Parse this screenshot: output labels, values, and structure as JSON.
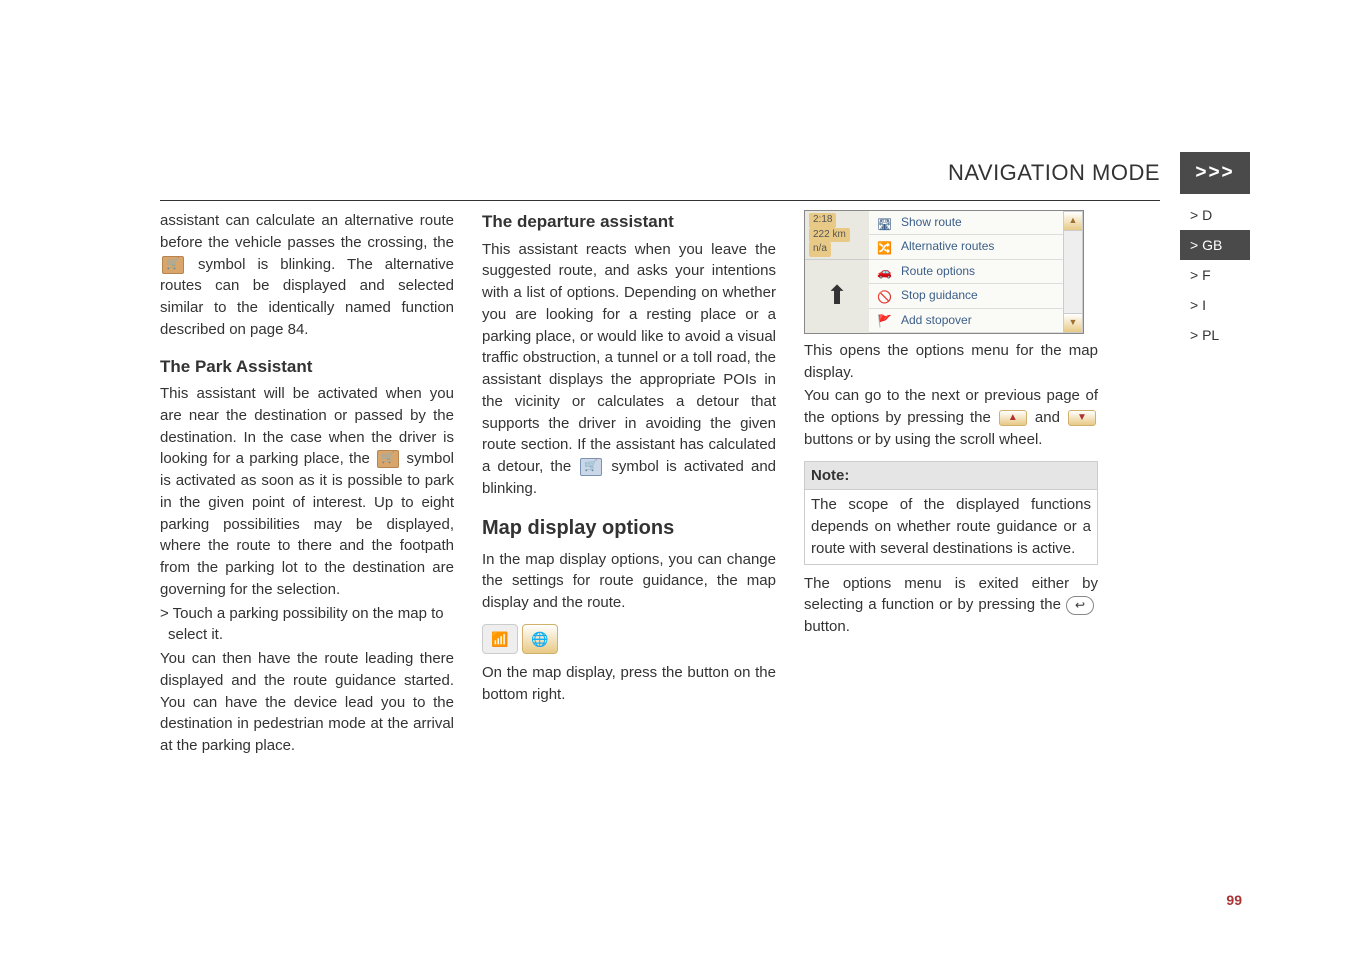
{
  "header": {
    "title": "NAVIGATION MODE",
    "chevrons": ">>>"
  },
  "lang_tabs": [
    {
      "label": "> D",
      "active": false
    },
    {
      "label": "> GB",
      "active": true
    },
    {
      "label": "> F",
      "active": false
    },
    {
      "label": "> I",
      "active": false
    },
    {
      "label": "> PL",
      "active": false
    }
  ],
  "col1": {
    "p1": "assistant can calculate an alternative route before the vehicle passes the crossing, the ",
    "p1b": " symbol is blinking. The alternative routes can be displayed and selected similar to the identically named function described on page 84.",
    "h_park": "The Park Assistant",
    "p2a": "This assistant will be activated when you are near the destination or passed by the destination. In the case when the driver is looking for a parking place, the ",
    "p2b": " symbol is activated as soon as it is possible to park in the given point of interest. Up to eight parking possibilities may be displayed, where the route to there and the footpath from the parking lot to the destination are governing for the selection.",
    "li1": "> Touch a parking possibility on the map to select it.",
    "p3": "You can then have the route leading there displayed and the route guidance started. You can have the device lead you to the destination in pedestrian mode at the arrival at the parking place."
  },
  "col2": {
    "h_dep": "The departure assistant",
    "p1a": "This assistant reacts when you leave the suggested route, and asks your intentions with a list of options. Depending on whether you are looking for a resting place or a parking place, or would like to avoid a visual traffic obstruction, a tunnel or a toll road, the assistant displays the appropriate POIs in the vicinity or calculates a detour that supports the driver in avoiding the given route section. If the assistant has calculated a detour, the ",
    "p1b": " symbol is activated and blinking.",
    "h_map": "Map display options",
    "p2": "In the map display options, you can change the settings for route guidance, the map display and the route.",
    "p3": "On the map display, press the button on the bottom right."
  },
  "col3": {
    "menu_left": {
      "time": "2:18",
      "dist": "222 km",
      "na": "n/a"
    },
    "menu_items": [
      "Show route",
      "Alternative routes",
      "Route options",
      "Stop guidance",
      "Add stopover"
    ],
    "p1": "This opens the options menu for the map display.",
    "p2a": "You can go to the next or previous page of the options by pressing the ",
    "p2b": " and ",
    "p2c": " buttons or by using the scroll wheel.",
    "note_head": "Note:",
    "note_body": "The scope of the displayed functions depends on whether route guidance or a route with several destinations is active.",
    "p3a": "The options menu is exited either by selecting a function or by pressing the ",
    "p3b": " button."
  },
  "page_number": "99"
}
